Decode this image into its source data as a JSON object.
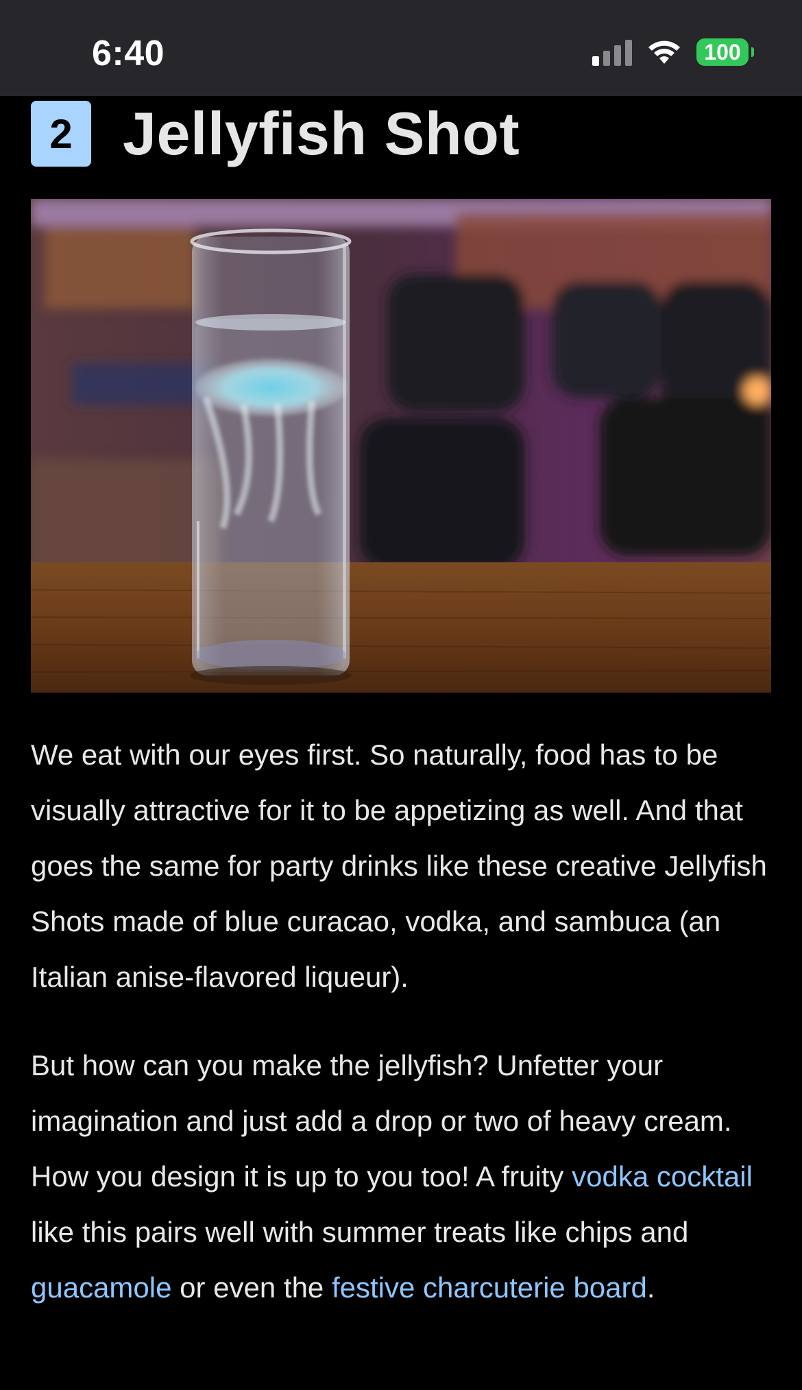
{
  "status_bar": {
    "time": "6:40",
    "battery": "100",
    "icons": [
      "cellular-signal-icon",
      "wifi-icon",
      "battery-icon"
    ]
  },
  "heading": {
    "number": "2",
    "title": "Jellyfish Shot"
  },
  "image": {
    "icon": "jellyfish-shot-photo"
  },
  "paragraphs": {
    "p1": "We eat with our eyes first. So naturally, food has to be visually attractive for it to be appetizing as well. And that goes the same for party drinks like these creative Jellyfish Shots made of blue curacao, vodka, and sambuca (an Italian anise-flavored liqueur).",
    "p2": {
      "t1": "But how can you make the jellyfish? Unfetter your imagination and just add a drop or two of heavy cream. How you design it is up to you too! A fruity ",
      "link1": "vodka cocktail",
      "t2": " like this pairs well with summer treats like chips and ",
      "link2": "guacamole",
      "t3": " or even the ",
      "link3": "festive charcuterie board",
      "t4": "."
    }
  },
  "colors": {
    "background": "#000000",
    "status_bar": "#26262b",
    "badge": "#a8d4ff",
    "link": "#8ec6ff",
    "battery": "#34c759"
  }
}
